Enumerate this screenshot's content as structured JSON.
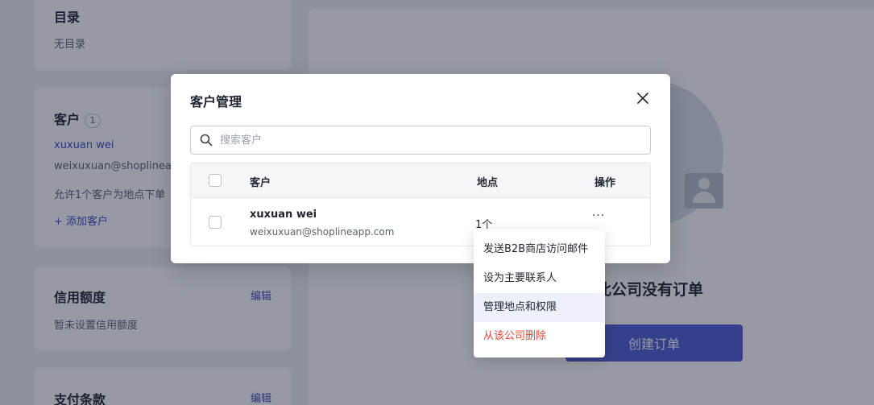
{
  "background": {
    "catalog": {
      "title": "目录",
      "text": "无目录"
    },
    "customers": {
      "title": "客户",
      "count": "1",
      "name": "xuxuan wei",
      "email": "weixuxuan@shoplineap",
      "note": "允许1个客户为地点下单",
      "add_link": "+ 添加客户"
    },
    "credit": {
      "title": "信用额度",
      "edit": "编辑",
      "text": "暂未设置信用额度"
    },
    "payment": {
      "title": "支付条款",
      "edit": "编辑"
    },
    "orders": {
      "empty_title": "此公司没有订单",
      "create_button": "创建订单"
    }
  },
  "modal": {
    "title": "客户管理",
    "search": {
      "placeholder": "搜索客户",
      "value": ""
    },
    "table": {
      "headers": {
        "customer": "客户",
        "location": "地点",
        "actions": "操作"
      },
      "rows": [
        {
          "name": "xuxuan wei",
          "email": "weixuxuan@shoplineapp.com",
          "location": "1个",
          "actions": "···"
        }
      ]
    }
  },
  "menu": {
    "items": [
      {
        "label": "发送B2B商店访问邮件",
        "state": "normal"
      },
      {
        "label": "设为主要联系人",
        "state": "normal"
      },
      {
        "label": "管理地点和权限",
        "state": "hover"
      },
      {
        "label": "从该公司删除",
        "state": "danger"
      }
    ]
  },
  "colors": {
    "accent": "#4c5bd4",
    "link": "#3b46c8",
    "danger": "#e5483b"
  },
  "icons": {
    "search": "search-icon",
    "close": "close-icon",
    "more": "more-horizontal-icon"
  }
}
